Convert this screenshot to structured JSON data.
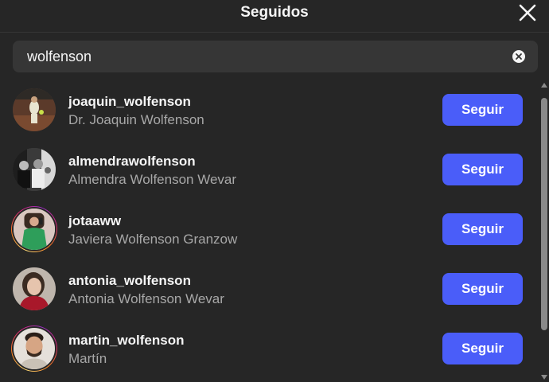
{
  "dialog": {
    "title": "Seguidos"
  },
  "search": {
    "value": "wolfenson"
  },
  "users": [
    {
      "username": "joaquin_wolfenson",
      "fullname": "Dr. Joaquin Wolfenson",
      "button": "Seguir",
      "has_story": false
    },
    {
      "username": "almendrawolfenson",
      "fullname": "Almendra Wolfenson Wevar",
      "button": "Seguir",
      "has_story": false
    },
    {
      "username": "jotaaww",
      "fullname": "Javiera Wolfenson Granzow",
      "button": "Seguir",
      "has_story": true
    },
    {
      "username": "antonia_wolfenson",
      "fullname": "Antonia Wolfenson Wevar",
      "button": "Seguir",
      "has_story": false
    },
    {
      "username": "martin_wolfenson",
      "fullname": "Martín",
      "button": "Seguir",
      "has_story": true
    }
  ],
  "icons": {
    "close": "close-icon",
    "clear": "clear-search-icon"
  },
  "colors": {
    "background": "#262626",
    "follow_button": "#4a5df9",
    "secondary_text": "#a8a8a8"
  }
}
